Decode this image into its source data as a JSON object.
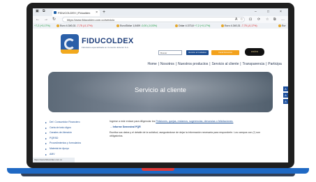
{
  "browser": {
    "tab_title": "FIDUCOLDEX | Fiduoldex",
    "tab_close": "×",
    "new_tab": "+",
    "url": "https://www.fiducoldex.com.co/servicio",
    "win_min": "–",
    "win_max": "□",
    "win_close": "×",
    "back": "←",
    "forward": "→",
    "reload": "↻",
    "toolbar_icons": [
      "A",
      "☆",
      "⊡",
      "⟳",
      "☆",
      "⧉",
      "…"
    ]
  },
  "ticker": [
    {
      "label": "+7,2 (+0,17%)",
      "dir": "up"
    },
    {
      "label": "Euro",
      "value": "4.340,31",
      "change": "-7,75 (-0,17%)",
      "dir": "down"
    },
    {
      "label": "Euro/Dólar",
      "value": "1,0409",
      "change": "-0,00 (-0,03%)",
      "dir": "up"
    },
    {
      "label": "Dólar",
      "value": "4.373,8",
      "change": "+7,2 (+0,17%)",
      "dir": "up"
    },
    {
      "label": "Euro",
      "value": "4.340,31",
      "change": "-7,75 (-0,17%)",
      "dir": "down"
    },
    {
      "label": "Eur",
      "value": "",
      "change": "",
      "dir": "up"
    }
  ],
  "header": {
    "logo_text": "FIDUCOLDEX",
    "logo_sub": "Fiduciaria especializada en Comercio Exterior S.A.",
    "search_placeholder": "Buscar",
    "btn_blue": "Atención al Ciudadano",
    "btn_orange": "Canal Denuncias",
    "gov_badge": "20AÑOS",
    "nav": [
      "Home",
      "Nosotros",
      "Nuestros productos",
      "Servicio al cliente",
      "Transparencia",
      "Participa"
    ]
  },
  "hero": {
    "title": "Servicio al cliente"
  },
  "side_tabs": [
    "A",
    "A",
    "A"
  ],
  "sidebar": [
    "Def. Consumidor Financiero",
    "Carta de trato digno",
    "Canales de Atención",
    "PQRSD",
    "Procedimientos y formularios",
    "Material de Apoyo",
    "AMV"
  ],
  "content": {
    "p1_prefix": "Ingrese a este enlace para diligenciar los",
    "p1_link": "Peticiones, quejas, reclamos, sugerencias, denuncias o felicitaciones.",
    "p2_link": "→ Informe Semestral PQR",
    "p3": "Escriba sus datos y el detalle de la solicitud, asegurándose de dejar la información necesaria para responderle. Los campos con (*) son obligatorios."
  },
  "status": "https://www.fiducoldex.com.co"
}
